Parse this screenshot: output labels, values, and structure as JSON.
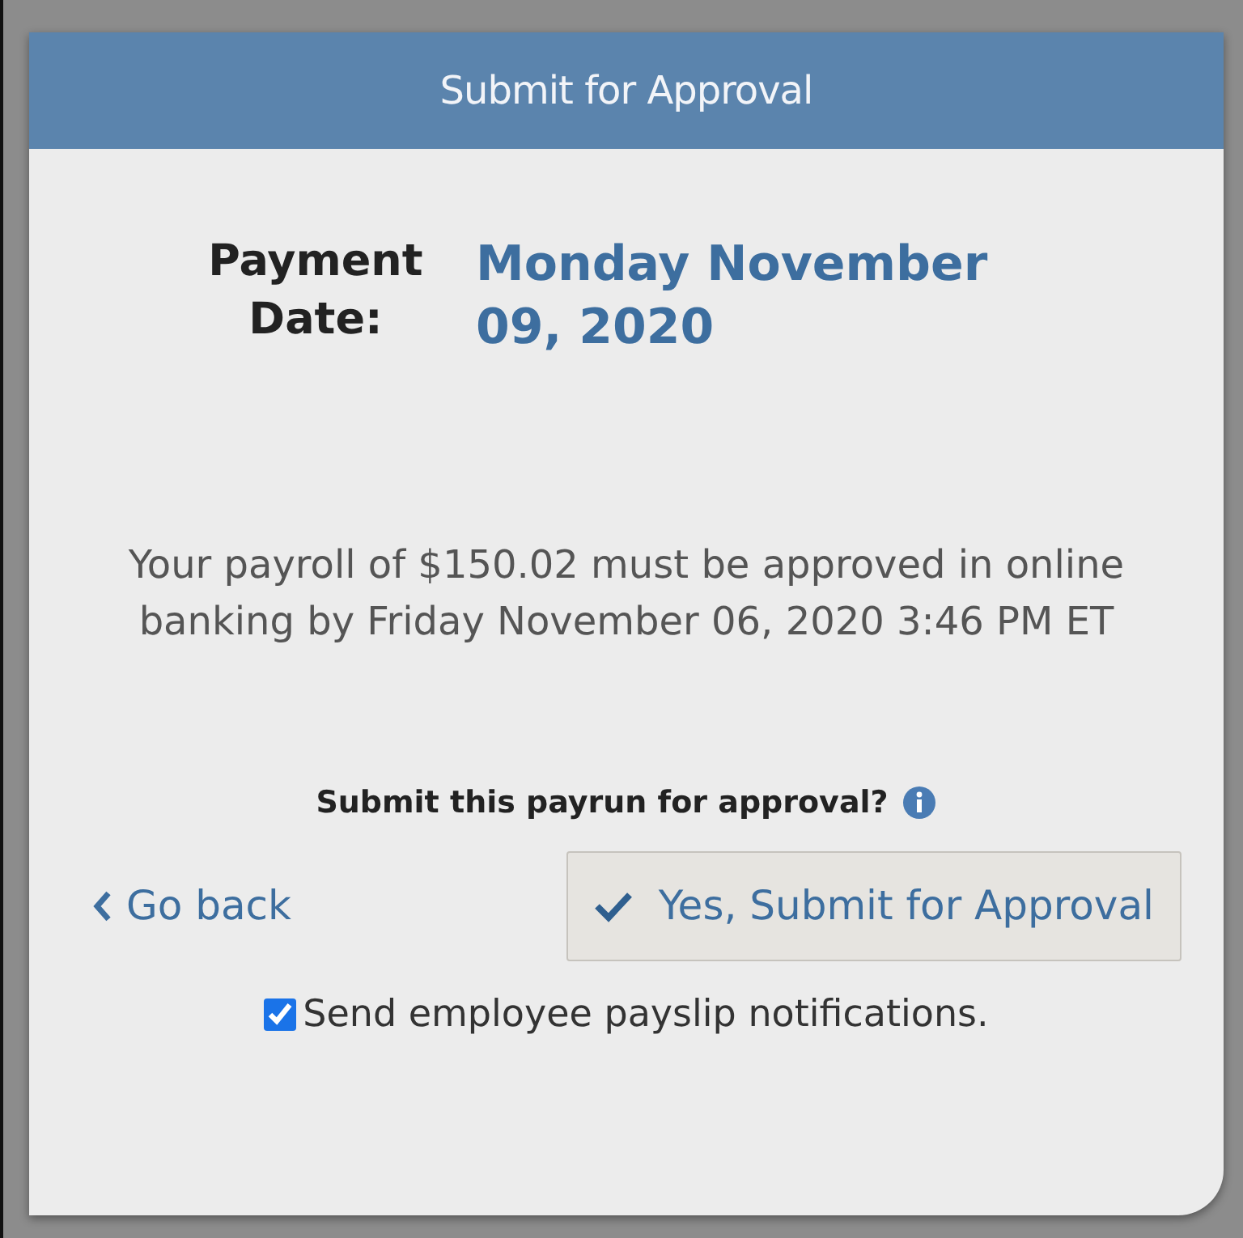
{
  "dialog": {
    "title": "Submit for Approval",
    "payment_date": {
      "label": "Payment Date:",
      "value": "Monday November 09, 2020"
    },
    "message": "Your payroll of $150.02 must be approved in online banking by Friday November 06, 2020 3:46 PM ET",
    "question": "Submit this payrun for approval?",
    "back_link": "Go back",
    "submit_button": "Yes, Submit for Approval",
    "notify": {
      "label": "Send employee payslip notifications.",
      "checked": true
    }
  }
}
